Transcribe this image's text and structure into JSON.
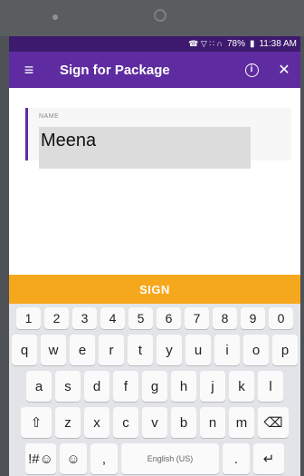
{
  "status_bar": {
    "icons": "☎ ▽ ∷ ∩",
    "battery": "78%",
    "time": "11:38 AM"
  },
  "app_bar": {
    "menu_icon": "≡",
    "title": "Sign for Package",
    "info_icon": "i",
    "close_icon": "✕"
  },
  "form": {
    "name_label": "NAME",
    "name_value": "Meena"
  },
  "sign_button": "SIGN",
  "keyboard": {
    "numbers": [
      "1",
      "2",
      "3",
      "4",
      "5",
      "6",
      "7",
      "8",
      "9",
      "0"
    ],
    "row1": [
      "q",
      "w",
      "e",
      "r",
      "t",
      "y",
      "u",
      "i",
      "o",
      "p"
    ],
    "row2": [
      "a",
      "s",
      "d",
      "f",
      "g",
      "h",
      "j",
      "k",
      "l"
    ],
    "row3": [
      "z",
      "x",
      "c",
      "v",
      "b",
      "n",
      "m"
    ],
    "shift": "⇧",
    "backspace": "⌫",
    "symbols": "!#☺",
    "emoji": "☺",
    "comma": ",",
    "space": "English (US)",
    "period": ".",
    "enter": "↵"
  },
  "colors": {
    "status_bar": "#3d1a6e",
    "app_bar": "#5e2ca0",
    "sign_button": "#f6a81c",
    "keyboard_bg": "#e2e4e7"
  }
}
